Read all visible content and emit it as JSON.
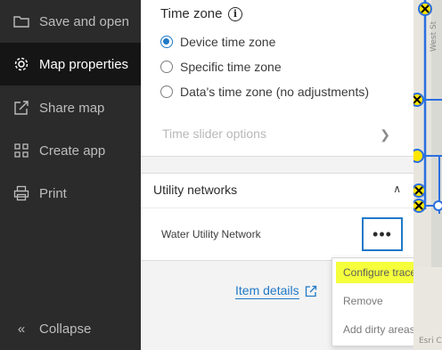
{
  "nav": {
    "items": [
      {
        "label": "Save and open",
        "icon": "folder-icon",
        "active": false
      },
      {
        "label": "Map properties",
        "icon": "gear-icon",
        "active": true
      },
      {
        "label": "Share map",
        "icon": "share-icon",
        "active": false
      },
      {
        "label": "Create app",
        "icon": "grid-icon",
        "active": false
      },
      {
        "label": "Print",
        "icon": "printer-icon",
        "active": false
      }
    ],
    "collapse_label": "Collapse"
  },
  "time_zone": {
    "title": "Time zone",
    "options": [
      {
        "label": "Device time zone",
        "checked": true
      },
      {
        "label": "Specific time zone",
        "checked": false
      },
      {
        "label": "Data's time zone (no adjustments)",
        "checked": false
      }
    ],
    "slider_options_label": "Time slider options"
  },
  "utility_networks": {
    "title": "Utility networks",
    "item_label": "Water Utility Network",
    "more_button_label": "•••"
  },
  "item_details_label": "Item details",
  "menu": {
    "items": [
      {
        "label": "Configure traces",
        "highlighted": true
      },
      {
        "label": "Remove",
        "highlighted": false
      },
      {
        "label": "Add dirty areas",
        "highlighted": false
      }
    ]
  },
  "map": {
    "street_label": "West St",
    "attribution": "Esri C"
  },
  "colors": {
    "accent": "#2079c7",
    "nav_bg": "#2b2b2b",
    "highlight": "#f5ff3c"
  }
}
